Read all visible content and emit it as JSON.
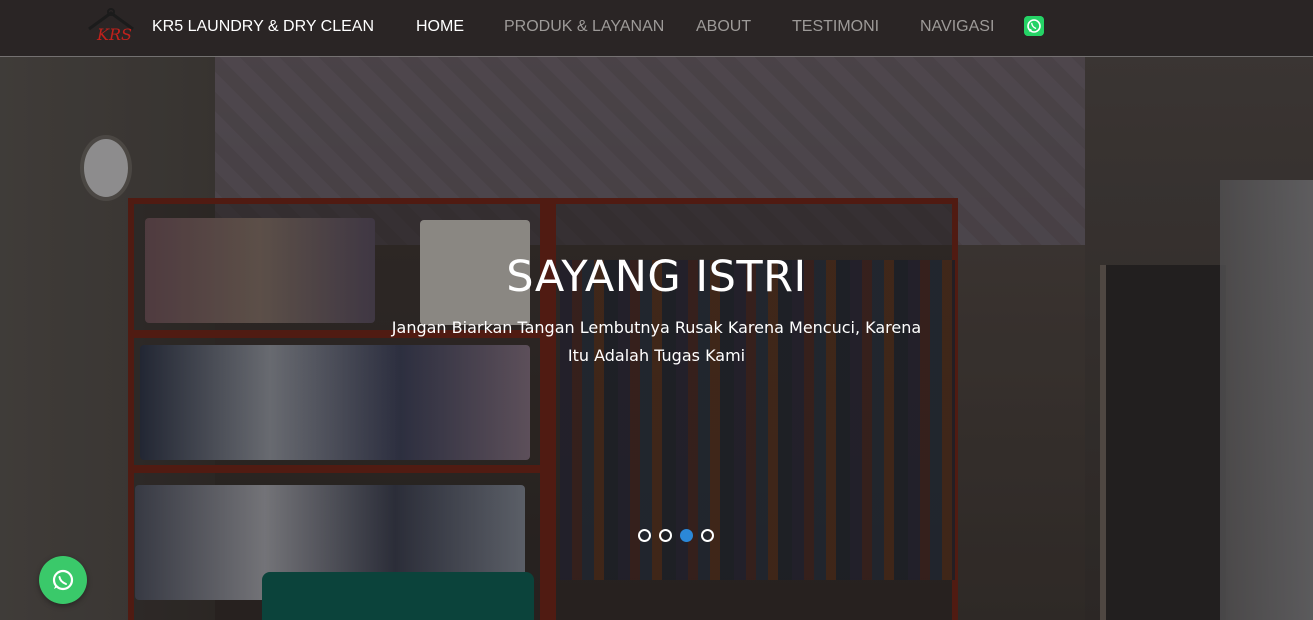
{
  "navbar": {
    "logo_text": "KRS",
    "brand": "KR5 LAUNDRY & DRY CLEAN",
    "items": [
      {
        "label": "HOME",
        "active": true
      },
      {
        "label": "PRODUK & LAYANAN",
        "active": false
      },
      {
        "label": "ABOUT",
        "active": false
      },
      {
        "label": "TESTIMONI",
        "active": false
      },
      {
        "label": "NAVIGASI",
        "active": false
      }
    ],
    "whatsapp_icon": "whatsapp-icon"
  },
  "carousel": {
    "title": "SAYANG ISTRI",
    "subtitle": "Jangan Biarkan Tangan Lembutnya Rusak Karena Mencuci, Karena Itu Adalah Tugas Kami",
    "slide_count": 4,
    "active_index": 2
  },
  "floating": {
    "whatsapp_icon": "whatsapp-icon"
  },
  "colors": {
    "accent": "#2b88d8",
    "whatsapp": "#25d366"
  }
}
